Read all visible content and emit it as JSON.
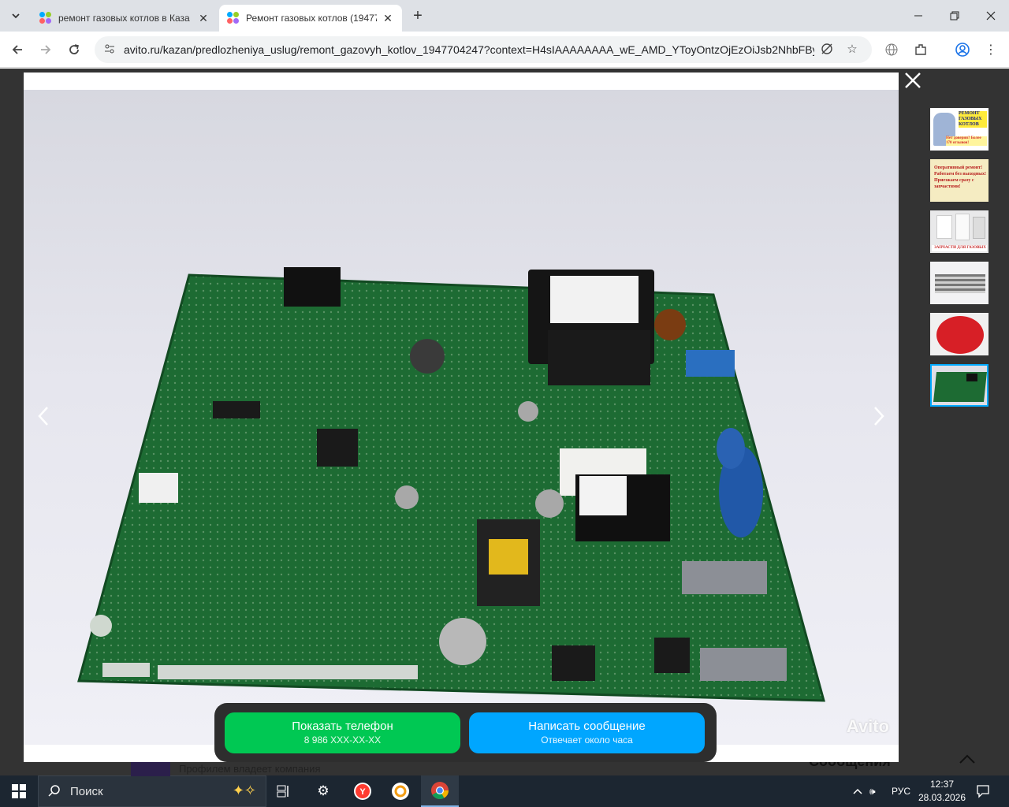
{
  "browser": {
    "tabs": [
      {
        "title": "ремонт газовых котлов в Каза",
        "active": false
      },
      {
        "title": "Ремонт газовых котлов (19477",
        "active": true
      }
    ],
    "url": "avito.ru/kazan/predlozheniya_uslug/remont_gazovyh_kotlov_1947704247?context=H4sIAAAAAAAA_wE_AMD_YToyOntzOjEzOiJsb2NhbFBya..."
  },
  "viewer": {
    "watermark": "Avito",
    "thumbnails": [
      {
        "label": "РЕМОНТ ГАЗОВЫХ КОТЛОВ",
        "caption": "Нет доверия? Более 170 отзывов!",
        "selected": false
      },
      {
        "label": "Оперативный ремонт! Работаем без выходных! Приезжаем сразу с запчастями!",
        "selected": false
      },
      {
        "label": "ЗАПЧАСТИ ДЛЯ ГАЗОВЫХ КОТЛОВ",
        "selected": false
      },
      {
        "label": "",
        "selected": false
      },
      {
        "label": "",
        "selected": false
      },
      {
        "label": "",
        "selected": true
      }
    ]
  },
  "cta": {
    "phone_label": "Показать телефон",
    "phone_sub": "8 986 XXX-XX-XX",
    "message_label": "Написать сообщение",
    "message_sub": "Отвечает около часа"
  },
  "page_behind": {
    "company_text": "Профилем владеет компания",
    "messages_heading": "Сообщения"
  },
  "taskbar": {
    "search_placeholder": "Поиск",
    "language": "РУС",
    "time": "12:37",
    "date": "28.03.2026"
  }
}
